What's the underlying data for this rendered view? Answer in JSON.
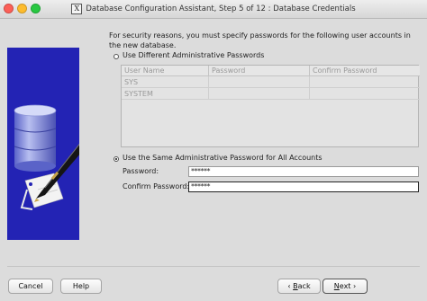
{
  "window": {
    "title": "Database Configuration Assistant, Step 5 of 12 : Database Credentials"
  },
  "intro_text": "For security reasons, you must specify passwords for the following user accounts in the new database.",
  "option_different": {
    "label": "Use Different Administrative Passwords",
    "selected": false
  },
  "accounts_table": {
    "columns": [
      "User Name",
      "Password",
      "Confirm Password"
    ],
    "rows": [
      {
        "user": "SYS",
        "password": "",
        "confirm": ""
      },
      {
        "user": "SYSTEM",
        "password": "",
        "confirm": ""
      }
    ]
  },
  "option_same": {
    "label": "Use the Same Administrative Password for All Accounts",
    "selected": true
  },
  "password_field": {
    "label": "Password:",
    "value": "******"
  },
  "confirm_field": {
    "label": "Confirm Password:",
    "value": "******"
  },
  "buttons": {
    "cancel": "Cancel",
    "help": "Help",
    "back_prefix": "",
    "back_mnemonic": "B",
    "back_rest": "ack",
    "next_mnemonic": "N",
    "next_rest": "ext"
  },
  "colors": {
    "art_background": "#2323b4",
    "window_background": "#dcdcdc"
  },
  "icons": {
    "title_app_icon": "x-window-icon",
    "back_arrow": "chevron-left-icon",
    "next_arrow": "chevron-right-icon",
    "illustration": "database-pen-illustration"
  }
}
